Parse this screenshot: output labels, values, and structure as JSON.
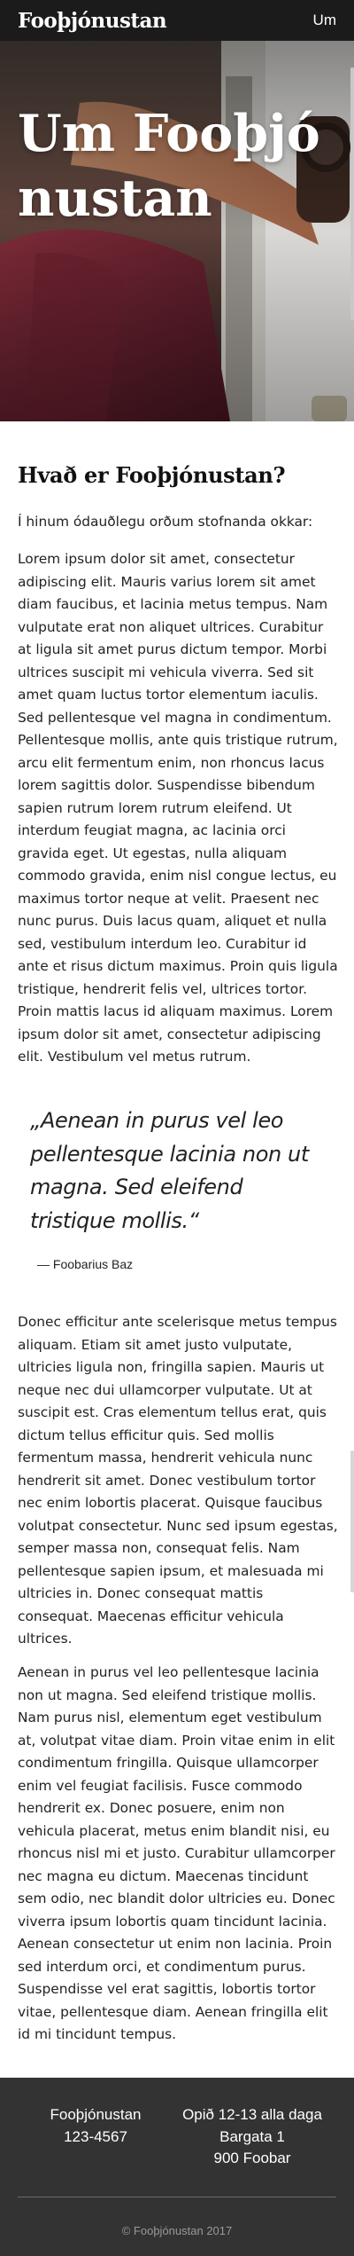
{
  "header": {
    "brand": "Fooþjónustan",
    "nav_link": "Um"
  },
  "hero": {
    "title": "Um Fooþjónustan"
  },
  "article": {
    "heading": "Hvað er Fooþjónustan?",
    "intro": "Í hinum ódauðlegu orðum stofnanda okkar:",
    "paragraph_1": "Lorem ipsum dolor sit amet, consectetur adipiscing elit. Mauris varius lorem sit amet diam faucibus, et lacinia metus tempus. Nam vulputate erat non aliquet ultrices. Curabitur at ligula sit amet purus dictum tempor. Morbi ultrices suscipit mi vehicula viverra. Sed sit amet quam luctus tortor elementum iaculis. Sed pellentesque vel magna in condimentum. Pellentesque mollis, ante quis tristique rutrum, arcu elit fermentum enim, non rhoncus lacus lorem sagittis dolor. Suspendisse bibendum sapien rutrum lorem rutrum eleifend. Ut interdum feugiat magna, ac lacinia orci gravida eget. Ut egestas, nulla aliquam commodo gravida, enim nisl congue lectus, eu maximus tortor neque at velit. Praesent nec nunc purus. Duis lacus quam, aliquet et nulla sed, vestibulum interdum leo. Curabitur id ante et risus dictum maximus. Proin quis ligula tristique, hendrerit felis vel, ultrices tortor. Proin mattis lacus id aliquam maximus. Lorem ipsum dolor sit amet, consectetur adipiscing elit. Vestibulum vel metus rutrum.",
    "quote": "„Aenean in purus vel leo pellentesque lacinia non ut magna. Sed eleifend tristique mollis.“",
    "quote_author": "— Foobarius Baz",
    "paragraph_2": "Donec efficitur ante scelerisque metus tempus aliquam. Etiam sit amet justo vulputate, ultricies ligula non, fringilla sapien. Mauris ut neque nec dui ullamcorper vulputate. Ut at suscipit est. Cras elementum tellus erat, quis dictum tellus efficitur quis. Sed mollis fermentum massa, hendrerit vehicula nunc hendrerit sit amet. Donec vestibulum tortor nec enim lobortis placerat. Quisque faucibus volutpat consectetur. Nunc sed ipsum egestas, semper massa non, consequat felis. Nam pellentesque sapien ipsum, et malesuada mi ultricies in. Donec consequat mattis consequat. Maecenas efficitur vehicula ultrices.",
    "paragraph_3": "Aenean in purus vel leo pellentesque lacinia non ut magna. Sed eleifend tristique mollis. Nam purus nisl, elementum eget vestibulum at, volutpat vitae diam. Proin vitae enim in elit condimentum fringilla. Quisque ullamcorper enim vel feugiat facilisis. Fusce commodo hendrerit ex. Donec posuere, enim non vehicula placerat, metus enim blandit nisi, eu rhoncus nisl mi et justo. Curabitur ullamcorper nec magna eu dictum. Maecenas tincidunt sem odio, nec blandit dolor ultricies eu. Donec viverra ipsum lobortis quam tincidunt lacinia. Aenean consectetur ut enim non lacinia. Proin sed interdum orci, et condimentum purus. Suspendisse vel erat sagittis, lobortis tortor vitae, pellentesque diam. Aenean fringilla elit id mi tincidunt tempus."
  },
  "footer": {
    "left": {
      "name": "Fooþjónustan",
      "phone": "123-4567"
    },
    "right": {
      "hours": "Opið 12-13 alla daga",
      "street": "Bargata 1",
      "postal": "900 Foobar"
    },
    "copyright": "© Fooþjónustan 2017"
  },
  "colors": {
    "header_bg": "#1b1b1b",
    "footer_bg": "#333333",
    "text": "#222222",
    "copyright": "#999999"
  }
}
